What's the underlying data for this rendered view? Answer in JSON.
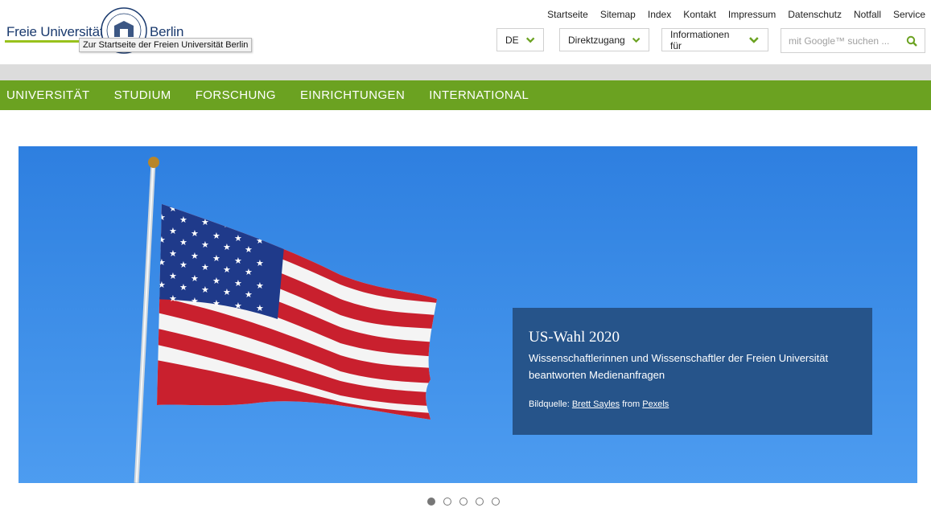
{
  "logo": {
    "text_left": "Freie Universität",
    "text_right": "Berlin",
    "tooltip": "Zur Startseite der Freien Universität Berlin"
  },
  "service_nav": [
    "Startseite",
    "Sitemap",
    "Index",
    "Kontakt",
    "Impressum",
    "Datenschutz",
    "Notfall",
    "Service"
  ],
  "language": {
    "selected": "DE"
  },
  "direktzugang": {
    "label": "Direktzugang"
  },
  "informationen": {
    "label": "Informationen für"
  },
  "search": {
    "placeholder": "mit Google™ suchen ..."
  },
  "main_nav": [
    "UNIVERSITÄT",
    "STUDIUM",
    "FORSCHUNG",
    "EINRICHTUNGEN",
    "INTERNATIONAL"
  ],
  "hero": {
    "title": "US-Wahl 2020",
    "subtitle": "Wissenschaftlerinnen und Wissenschaftler der Freien Universität beantworten Medienanfragen",
    "credit_prefix": "Bildquelle:",
    "credit_author": "Brett Sayles",
    "credit_from": "from",
    "credit_source": "Pexels"
  },
  "carousel": {
    "total": 5,
    "active": 1
  },
  "colors": {
    "accent_green": "#6ba221",
    "caption_blue": "#26548a",
    "sky_blue": "#3a8be6"
  }
}
